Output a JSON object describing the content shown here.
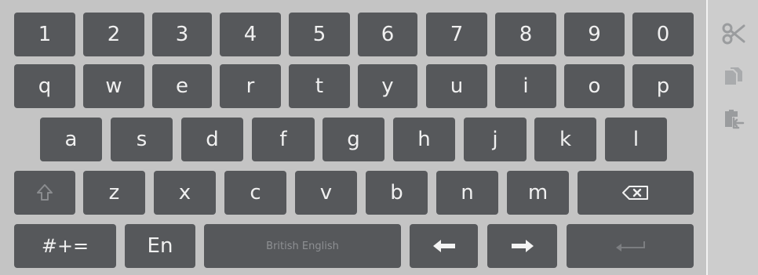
{
  "keyboard": {
    "row1": [
      "1",
      "2",
      "3",
      "4",
      "5",
      "6",
      "7",
      "8",
      "9",
      "0"
    ],
    "row2": [
      "q",
      "w",
      "e",
      "r",
      "t",
      "y",
      "u",
      "i",
      "o",
      "p"
    ],
    "row3": [
      "a",
      "s",
      "d",
      "f",
      "g",
      "h",
      "j",
      "k",
      "l"
    ],
    "row4": [
      "z",
      "x",
      "c",
      "v",
      "b",
      "n",
      "m"
    ],
    "symbols_label": "#+=",
    "language_label": "En",
    "space_label": "British English",
    "icons": {
      "shift": "shift-arrow-icon",
      "backspace": "backspace-icon",
      "left": "arrow-left-icon",
      "right": "arrow-right-icon",
      "enter": "enter-icon"
    }
  },
  "side_panel": {
    "icons": [
      "scissors-icon",
      "copy-icon",
      "paste-icon"
    ]
  },
  "colors": {
    "key": "#56585b",
    "key_text": "#f0f0f0",
    "background": "#c4c4c4",
    "disabled_icon": "#9a9c9e"
  }
}
